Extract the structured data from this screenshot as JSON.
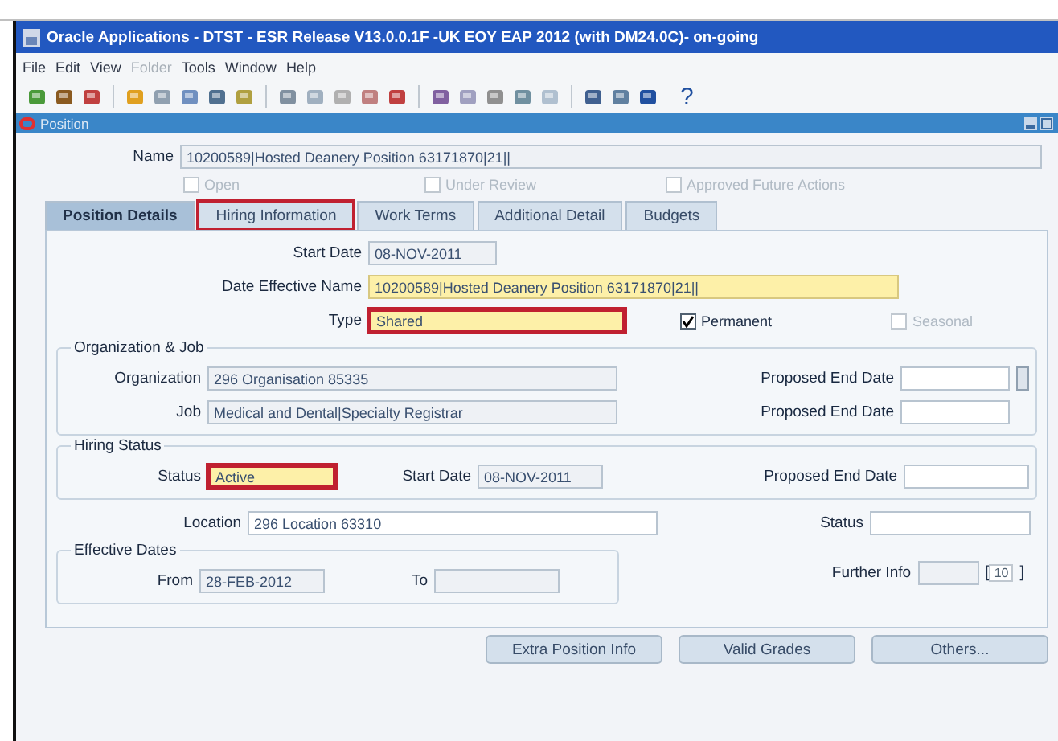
{
  "window": {
    "title": "Oracle Applications - DTST - ESR Release V13.0.0.1F -UK EOY EAP 2012 (with DM24.0C)- on-going"
  },
  "menu": [
    {
      "label": "File",
      "disabled": false
    },
    {
      "label": "Edit",
      "disabled": false
    },
    {
      "label": "View",
      "disabled": false
    },
    {
      "label": "Folder",
      "disabled": true
    },
    {
      "label": "Tools",
      "disabled": false
    },
    {
      "label": "Window",
      "disabled": false
    },
    {
      "label": "Help",
      "disabled": false
    }
  ],
  "toolbar": {
    "help": "?"
  },
  "form": {
    "title": "Position",
    "name_label": "Name",
    "name_value": "10200589|Hosted Deanery Position 63171870|21||",
    "flags": [
      {
        "label": "Open",
        "checked": false
      },
      {
        "label": "Under Review",
        "checked": false
      },
      {
        "label": "Approved Future Actions",
        "checked": false
      }
    ],
    "tabs": [
      {
        "label": "Position Details",
        "selected": true,
        "highlighted": false
      },
      {
        "label": "Hiring Information",
        "selected": false,
        "highlighted": true
      },
      {
        "label": "Work Terms",
        "selected": false,
        "highlighted": false
      },
      {
        "label": "Additional Detail",
        "selected": false,
        "highlighted": false
      },
      {
        "label": "Budgets",
        "selected": false,
        "highlighted": false
      }
    ],
    "start_date": {
      "label": "Start Date",
      "value": "08-NOV-2011",
      "required": false,
      "highlighted": false
    },
    "date_effective_name": {
      "label": "Date Effective Name",
      "value": "10200589|Hosted Deanery Position 63171870|21||",
      "required": true,
      "highlighted": false
    },
    "type": {
      "label": "Type",
      "value": "Shared",
      "required": true,
      "highlighted": true
    },
    "permanent": {
      "label": "Permanent",
      "checked": true
    },
    "seasonal": {
      "label": "Seasonal",
      "checked": false
    },
    "org_job": {
      "title": "Organization & Job",
      "organization": {
        "label": "Organization",
        "value": "296 Organisation 85335",
        "required": false,
        "highlighted": false
      },
      "job": {
        "label": "Job",
        "value": "Medical and Dental|Specialty Registrar",
        "required": false,
        "highlighted": false
      },
      "end_dates": [
        {
          "label": "Proposed End Date",
          "required": false,
          "highlighted": false
        },
        {
          "label": "Proposed End Date",
          "required": false,
          "highlighted": false
        }
      ]
    },
    "hiring_status": {
      "title": "Hiring Status",
      "status": {
        "label": "Status",
        "value": "Active",
        "required": true,
        "highlighted": true
      },
      "start_date": {
        "label": "Start Date",
        "value": "08-NOV-2011",
        "required": false,
        "highlighted": false
      },
      "end_date": {
        "label": "Proposed End Date",
        "required": false,
        "highlighted": false
      }
    },
    "location": {
      "label": "Location",
      "value": "296 Location 63310",
      "required": false,
      "highlighted": false
    },
    "status": {
      "label": "Status",
      "required": false,
      "highlighted": false
    },
    "effective_dates": {
      "title": "Effective Dates",
      "from": {
        "label": "From",
        "value": "28-FEB-2012",
        "required": false,
        "highlighted": false
      },
      "to": {
        "label": "To",
        "required": false,
        "highlighted": false
      }
    },
    "further_info": {
      "label": "Further Info",
      "required": false,
      "highlighted": false
    },
    "bracket_open": "[",
    "bracket_value": "10",
    "bracket_close": "]",
    "buttons": [
      "Extra Position Info",
      "Valid Grades",
      "Others..."
    ]
  }
}
